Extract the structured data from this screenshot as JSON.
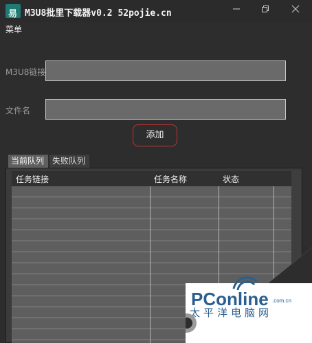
{
  "window": {
    "title": "M3U8批里下载器v0.2 52pojie.cn",
    "app_icon_glyph": "易"
  },
  "menu": {
    "label": "菜单"
  },
  "form": {
    "url_label": "M3U8链接",
    "url_value": "",
    "name_label": "文件名",
    "name_value": "",
    "add_button": "添加"
  },
  "tabs": [
    {
      "label": "当前队列",
      "active": true
    },
    {
      "label": "失败队列",
      "active": false
    }
  ],
  "table": {
    "columns": [
      "任务链接",
      "任务名称",
      "状态"
    ],
    "rows": []
  },
  "watermark": {
    "brand": "PConline",
    "domain": ".com.cn",
    "tagline": "太平洋电脑网"
  },
  "colors": {
    "background": "#2d2d2d",
    "input_bg": "#6a6a6a",
    "button_border": "#c43434",
    "table_bg": "#5e5e5e",
    "watermark_bg": "#2a5f8f"
  }
}
